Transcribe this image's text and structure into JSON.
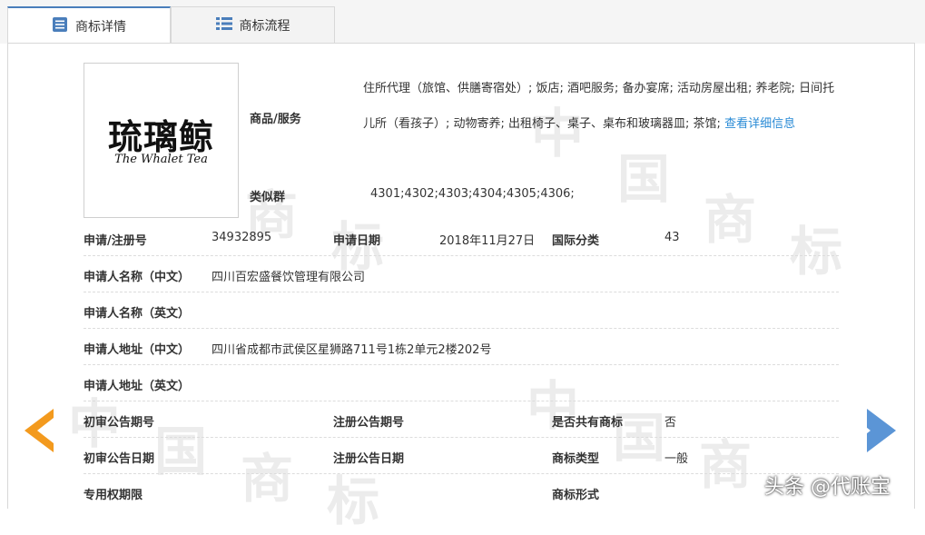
{
  "tabs": [
    {
      "label": "商标详情",
      "icon": "list-icon",
      "active": true
    },
    {
      "label": "商标流程",
      "icon": "grid-icon",
      "active": false
    }
  ],
  "logo": {
    "cn": "琉璃鲸",
    "en": "The Whalet Tea"
  },
  "goods": {
    "label": "商品/服务",
    "text": "住所代理（旅馆、供膳寄宿处）; 饭店; 酒吧服务; 备办宴席; 活动房屋出租; 养老院; 日间托儿所（看孩子）; 动物寄养; 出租椅子、桌子、桌布和玻璃器皿; 茶馆; ",
    "link": "查看详细信息"
  },
  "similar_group": {
    "label": "类似群",
    "value": "4301;4302;4303;4304;4305;4306;"
  },
  "rows": {
    "reg_no_label": "申请/注册号",
    "reg_no": "34932895",
    "apply_date_label": "申请日期",
    "apply_date": "2018年11月27日",
    "intl_class_label": "国际分类",
    "intl_class": "43",
    "applicant_cn_label": "申请人名称（中文）",
    "applicant_cn": "四川百宏盛餐饮管理有限公司",
    "applicant_en_label": "申请人名称（英文）",
    "address_cn_label": "申请人地址（中文）",
    "address_cn": "四川省成都市武侯区星狮路711号1栋2单元2楼202号",
    "address_en_label": "申请人地址（英文）",
    "prelim_no_label": "初审公告期号",
    "reg_pub_no_label": "注册公告期号",
    "shared_label": "是否共有商标",
    "shared": "否",
    "prelim_date_label": "初审公告日期",
    "reg_pub_date_label": "注册公告日期",
    "tm_type_label": "商标类型",
    "tm_type": "一般",
    "exclusive_label": "专用权期限",
    "tm_form_label": "商标形式"
  },
  "watermark": {
    "char1": "中",
    "char2": "国",
    "char3": "商",
    "char4": "标"
  },
  "footer_watermark": "头条 @代账宝",
  "colors": {
    "accent": "#4a7ebb",
    "link": "#2a8bd6",
    "arrow_left": "#f39a1e",
    "arrow_right": "#5b95d6"
  }
}
